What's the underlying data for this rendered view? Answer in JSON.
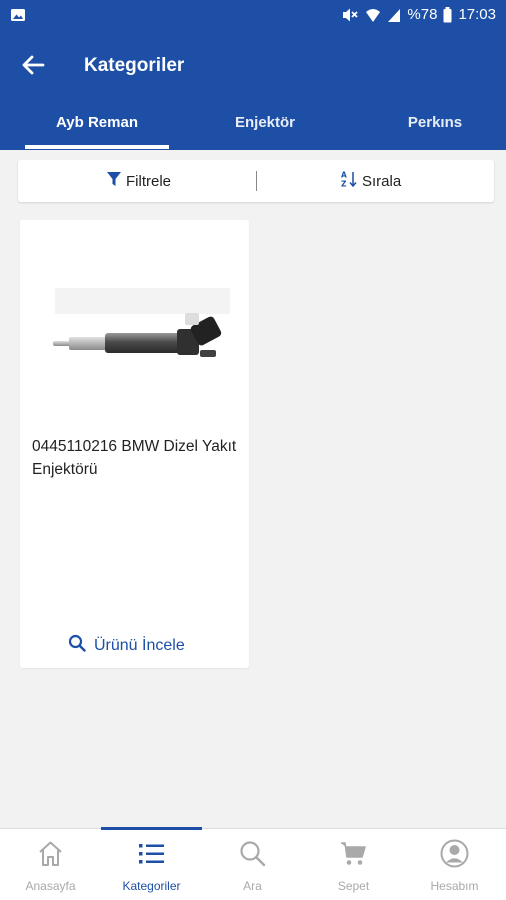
{
  "status_bar": {
    "battery": "%78",
    "time": "17:03"
  },
  "app_bar": {
    "title": "Kategoriler"
  },
  "tabs": [
    {
      "label": "Ayb Reman",
      "selected": true
    },
    {
      "label": "Enjektör",
      "selected": false
    },
    {
      "label": "Perkıns",
      "selected": false
    }
  ],
  "toolbar": {
    "filter_label": "Filtrele",
    "sort_label": "Sırala"
  },
  "products": [
    {
      "title": "0445110216 BMW Dizel Yakıt Enjektörü",
      "action_label": "Ürünü İncele"
    }
  ],
  "bottom_nav": [
    {
      "label": "Anasayfa",
      "icon": "home-icon",
      "active": false
    },
    {
      "label": "Kategoriler",
      "icon": "list-icon",
      "active": true
    },
    {
      "label": "Ara",
      "icon": "search-icon",
      "active": false
    },
    {
      "label": "Sepet",
      "icon": "cart-icon",
      "active": false
    },
    {
      "label": "Hesabım",
      "icon": "account-icon",
      "active": false
    }
  ],
  "colors": {
    "primary": "#1d4fa6",
    "background": "#f2f2f2",
    "inactive": "#a9a9a9"
  }
}
